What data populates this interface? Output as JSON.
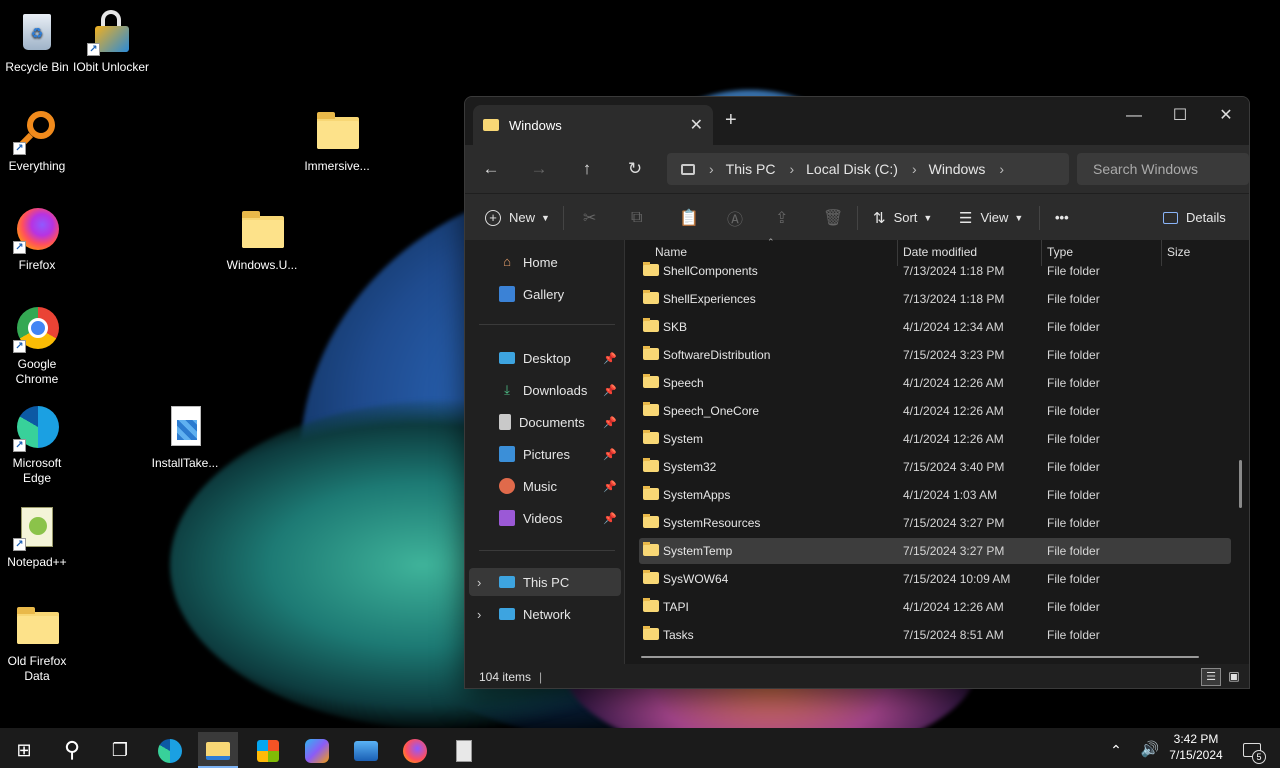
{
  "desktop": {
    "icons": [
      {
        "label": "Recycle Bin",
        "icon": "recycle-bin-icon"
      },
      {
        "label": "IObit Unlocker",
        "icon": "iobit-unlocker-icon"
      },
      {
        "label": "Everything",
        "icon": "everything-search-icon"
      },
      {
        "label": "Immersive...",
        "icon": "folder-icon"
      },
      {
        "label": "Firefox",
        "icon": "firefox-icon"
      },
      {
        "label": "Windows.U...",
        "icon": "folder-icon"
      },
      {
        "label": "Google Chrome",
        "icon": "chrome-icon"
      },
      {
        "label": "Microsoft Edge",
        "icon": "edge-icon"
      },
      {
        "label": "InstallTake...",
        "icon": "installer-icon"
      },
      {
        "label": "Notepad++",
        "icon": "notepadpp-icon"
      },
      {
        "label": "Old Firefox Data",
        "icon": "folder-icon"
      }
    ]
  },
  "explorer": {
    "tab_title": "Windows",
    "search_placeholder": "Search Windows",
    "breadcrumb": [
      "This PC",
      "Local Disk (C:)",
      "Windows"
    ],
    "commands": {
      "new": "New",
      "sort": "Sort",
      "view": "View",
      "more": "•••",
      "details": "Details"
    },
    "nav_pane": {
      "top": [
        {
          "label": "Home",
          "icon": "home-icon"
        },
        {
          "label": "Gallery",
          "icon": "gallery-icon"
        }
      ],
      "quick": [
        {
          "label": "Desktop",
          "icon": "desktop-icon"
        },
        {
          "label": "Downloads",
          "icon": "download-icon"
        },
        {
          "label": "Documents",
          "icon": "documents-icon"
        },
        {
          "label": "Pictures",
          "icon": "pictures-icon"
        },
        {
          "label": "Music",
          "icon": "music-icon"
        },
        {
          "label": "Videos",
          "icon": "videos-icon"
        }
      ],
      "bottom": [
        {
          "label": "This PC",
          "icon": "monitor-icon"
        },
        {
          "label": "Network",
          "icon": "network-icon"
        }
      ]
    },
    "columns": {
      "name": "Name",
      "date": "Date modified",
      "type": "Type",
      "size": "Size"
    },
    "files": [
      {
        "name": "ShellComponents",
        "date": "7/13/2024 1:18 PM",
        "type": "File folder"
      },
      {
        "name": "ShellExperiences",
        "date": "7/13/2024 1:18 PM",
        "type": "File folder"
      },
      {
        "name": "SKB",
        "date": "4/1/2024 12:34 AM",
        "type": "File folder"
      },
      {
        "name": "SoftwareDistribution",
        "date": "7/15/2024 3:23 PM",
        "type": "File folder"
      },
      {
        "name": "Speech",
        "date": "4/1/2024 12:26 AM",
        "type": "File folder"
      },
      {
        "name": "Speech_OneCore",
        "date": "4/1/2024 12:26 AM",
        "type": "File folder"
      },
      {
        "name": "System",
        "date": "4/1/2024 12:26 AM",
        "type": "File folder"
      },
      {
        "name": "System32",
        "date": "7/15/2024 3:40 PM",
        "type": "File folder"
      },
      {
        "name": "SystemApps",
        "date": "4/1/2024 1:03 AM",
        "type": "File folder"
      },
      {
        "name": "SystemResources",
        "date": "7/15/2024 3:27 PM",
        "type": "File folder"
      },
      {
        "name": "SystemTemp",
        "date": "7/15/2024 3:27 PM",
        "type": "File folder"
      },
      {
        "name": "SysWOW64",
        "date": "7/15/2024 10:09 AM",
        "type": "File folder"
      },
      {
        "name": "TAPI",
        "date": "4/1/2024 12:26 AM",
        "type": "File folder"
      },
      {
        "name": "Tasks",
        "date": "7/15/2024 8:51 AM",
        "type": "File folder"
      }
    ],
    "hovered_row": "SystemTemp",
    "status": "104 items"
  },
  "taskbar": {
    "time": "3:42 PM",
    "date": "7/15/2024",
    "notification_count": "5",
    "icons": [
      "start-icon",
      "search-icon",
      "task-view-icon",
      "edge-icon",
      "file-explorer-icon",
      "store-icon",
      "copilot-icon",
      "photos-icon",
      "firefox-icon",
      "notepad-icon"
    ]
  },
  "colors": {
    "accent": "#7eb4f5",
    "folder": "#f8d775",
    "window_bg": "#202020"
  }
}
